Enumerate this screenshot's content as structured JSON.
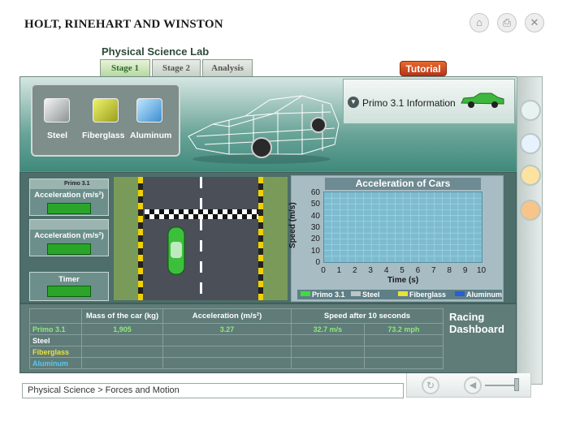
{
  "header": {
    "publisher": "HOLT, RINEHART AND WINSTON"
  },
  "top_icons": [
    "home-icon",
    "print-icon",
    "close-icon"
  ],
  "lab": {
    "title": "Physical Science Lab",
    "tabs": [
      {
        "label": "Stage 1",
        "active": true
      },
      {
        "label": "Stage 2",
        "active": false
      },
      {
        "label": "Analysis",
        "active": false
      }
    ],
    "tutorial_label": "Tutorial"
  },
  "materials": [
    {
      "label": "Steel",
      "color": "#d8dcdc"
    },
    {
      "label": "Fiberglass",
      "color": "#d6dc3a"
    },
    {
      "label": "Aluminum",
      "color": "#6fb7e8"
    }
  ],
  "info": {
    "label": "Primo 3.1 Information"
  },
  "left_cards": [
    {
      "name": "Primo 3.1",
      "label": "Acceleration (m/s²)"
    },
    {
      "name": "",
      "label": "Acceleration (m/s²)"
    },
    {
      "name": "",
      "label": "Timer"
    }
  ],
  "chart_data": {
    "type": "line",
    "title": "Acceleration of Cars",
    "xlabel": "Time (s)",
    "ylabel": "Speed (m/s)",
    "x_ticks": [
      "0",
      "1",
      "2",
      "3",
      "4",
      "5",
      "6",
      "7",
      "8",
      "9",
      "10"
    ],
    "y_ticks": [
      "0",
      "10",
      "20",
      "30",
      "40",
      "50",
      "60"
    ],
    "xlim": [
      0,
      10
    ],
    "ylim": [
      0,
      60
    ],
    "grid": true,
    "series": [
      {
        "name": "Primo 3.1",
        "color": "#3fdc3f",
        "values": []
      },
      {
        "name": "Steel",
        "color": "#bfc6c6",
        "values": []
      },
      {
        "name": "Fiberglass",
        "color": "#e8e23a",
        "values": []
      },
      {
        "name": "Aluminum",
        "color": "#2a5cd8",
        "values": []
      }
    ]
  },
  "table": {
    "headers": [
      "",
      "Mass of the car (kg)",
      "Acceleration (m/s²)",
      "Speed after 10 seconds",
      ""
    ],
    "rows": [
      {
        "name": "Primo 3.1",
        "color": "#8fe87a",
        "mass": "1,905",
        "accel": "3.27",
        "speed_ms": "32.7 m/s",
        "speed_mph": "73.2 mph"
      },
      {
        "name": "Steel",
        "color": "#ffffff",
        "mass": "",
        "accel": "",
        "speed_ms": "",
        "speed_mph": ""
      },
      {
        "name": "Fiberglass",
        "color": "#e8e23a",
        "mass": "",
        "accel": "",
        "speed_ms": "",
        "speed_mph": ""
      },
      {
        "name": "Aluminum",
        "color": "#5ac8f0",
        "mass": "",
        "accel": "",
        "speed_ms": "",
        "speed_mph": ""
      }
    ]
  },
  "dashboard": {
    "line1": "Racing",
    "line2": "Dashboard"
  },
  "breadcrumb": {
    "text": "Physical Science  > Forces and Motion"
  }
}
